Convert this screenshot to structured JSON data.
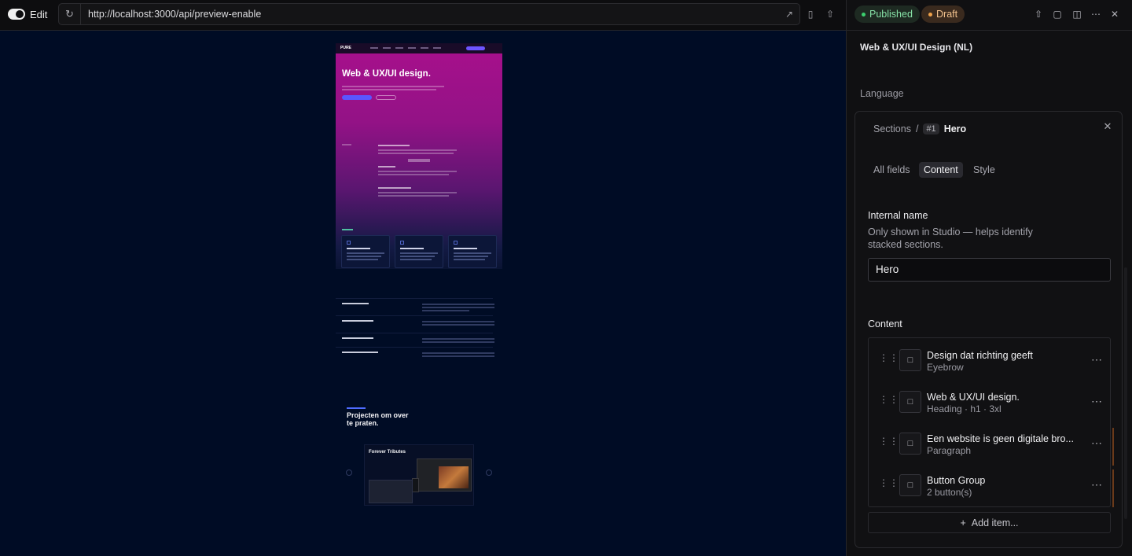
{
  "toolbar": {
    "edit_label": "Edit",
    "url": "http://localhost:3000/api/preview-enable"
  },
  "preview": {
    "hero_heading": "Web & UX/UI design.",
    "logo": "PURE",
    "projects_title": "Projecten om over te praten.",
    "slide_title": "Forever Tributes"
  },
  "panel": {
    "badge_published": "Published",
    "badge_draft": "Draft",
    "document_title": "Web & UX/UI Design (NL)",
    "language_label": "Language",
    "breadcrumb": {
      "sections": "Sections",
      "separator": "/",
      "number": "#1",
      "current": "Hero"
    },
    "tabs": [
      {
        "label": "All fields"
      },
      {
        "label": "Content"
      },
      {
        "label": "Style"
      }
    ],
    "internal_name": {
      "label": "Internal name",
      "help": "Only shown in Studio — helps identify stacked sections.",
      "value": "Hero"
    },
    "content": {
      "label": "Content",
      "items": [
        {
          "title": "Design dat richting geeft",
          "subtitle": "Eyebrow"
        },
        {
          "title": "Web & UX/UI design.",
          "subtitle": "Heading · h1 · 3xl"
        },
        {
          "title": "Een website is geen digitale bro...",
          "subtitle": "Paragraph"
        },
        {
          "title": "Button Group",
          "subtitle": "2 button(s)"
        }
      ],
      "add_item": "Add item..."
    }
  },
  "colors": {
    "published": "#3ccf6e",
    "draft": "#f0a24a",
    "hero_magenta": "#a8108c",
    "canvas": "#000c25"
  }
}
